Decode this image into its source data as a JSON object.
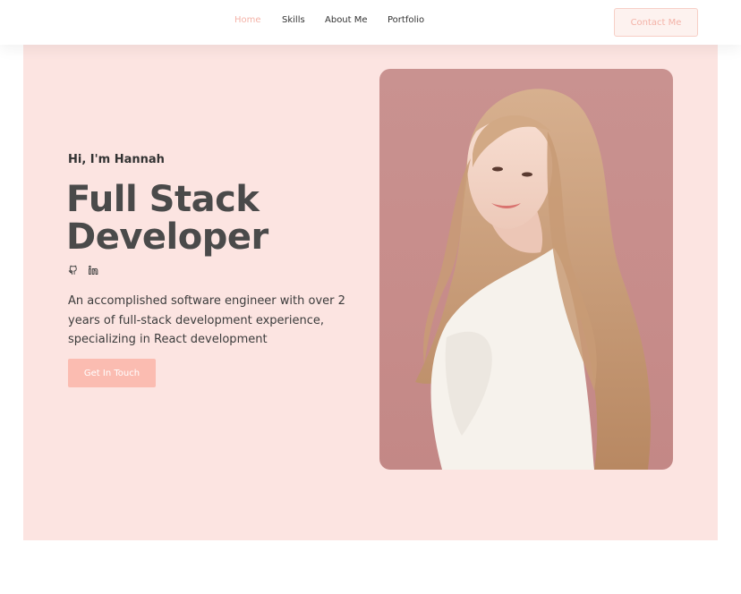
{
  "nav": {
    "links": [
      "Home",
      "Skills",
      "About Me",
      "Portfolio"
    ],
    "active_index": 0,
    "contact_label": "Contact Me"
  },
  "hero": {
    "greeting": "Hi, I'm Hannah",
    "headline_line1": "Full Stack",
    "headline_line2": "Developer",
    "bio": "An accomplished software engineer with over 2 years of full-stack development experience, specializing in React development",
    "cta_label": "Get In Touch",
    "socials": [
      "github-icon",
      "linkedin-icon"
    ]
  },
  "colors": {
    "accent": "#f4b3a8",
    "hero_bg": "#fce4e1",
    "button_bg": "#fbbcb1",
    "text_dark": "#4a4a4a"
  }
}
